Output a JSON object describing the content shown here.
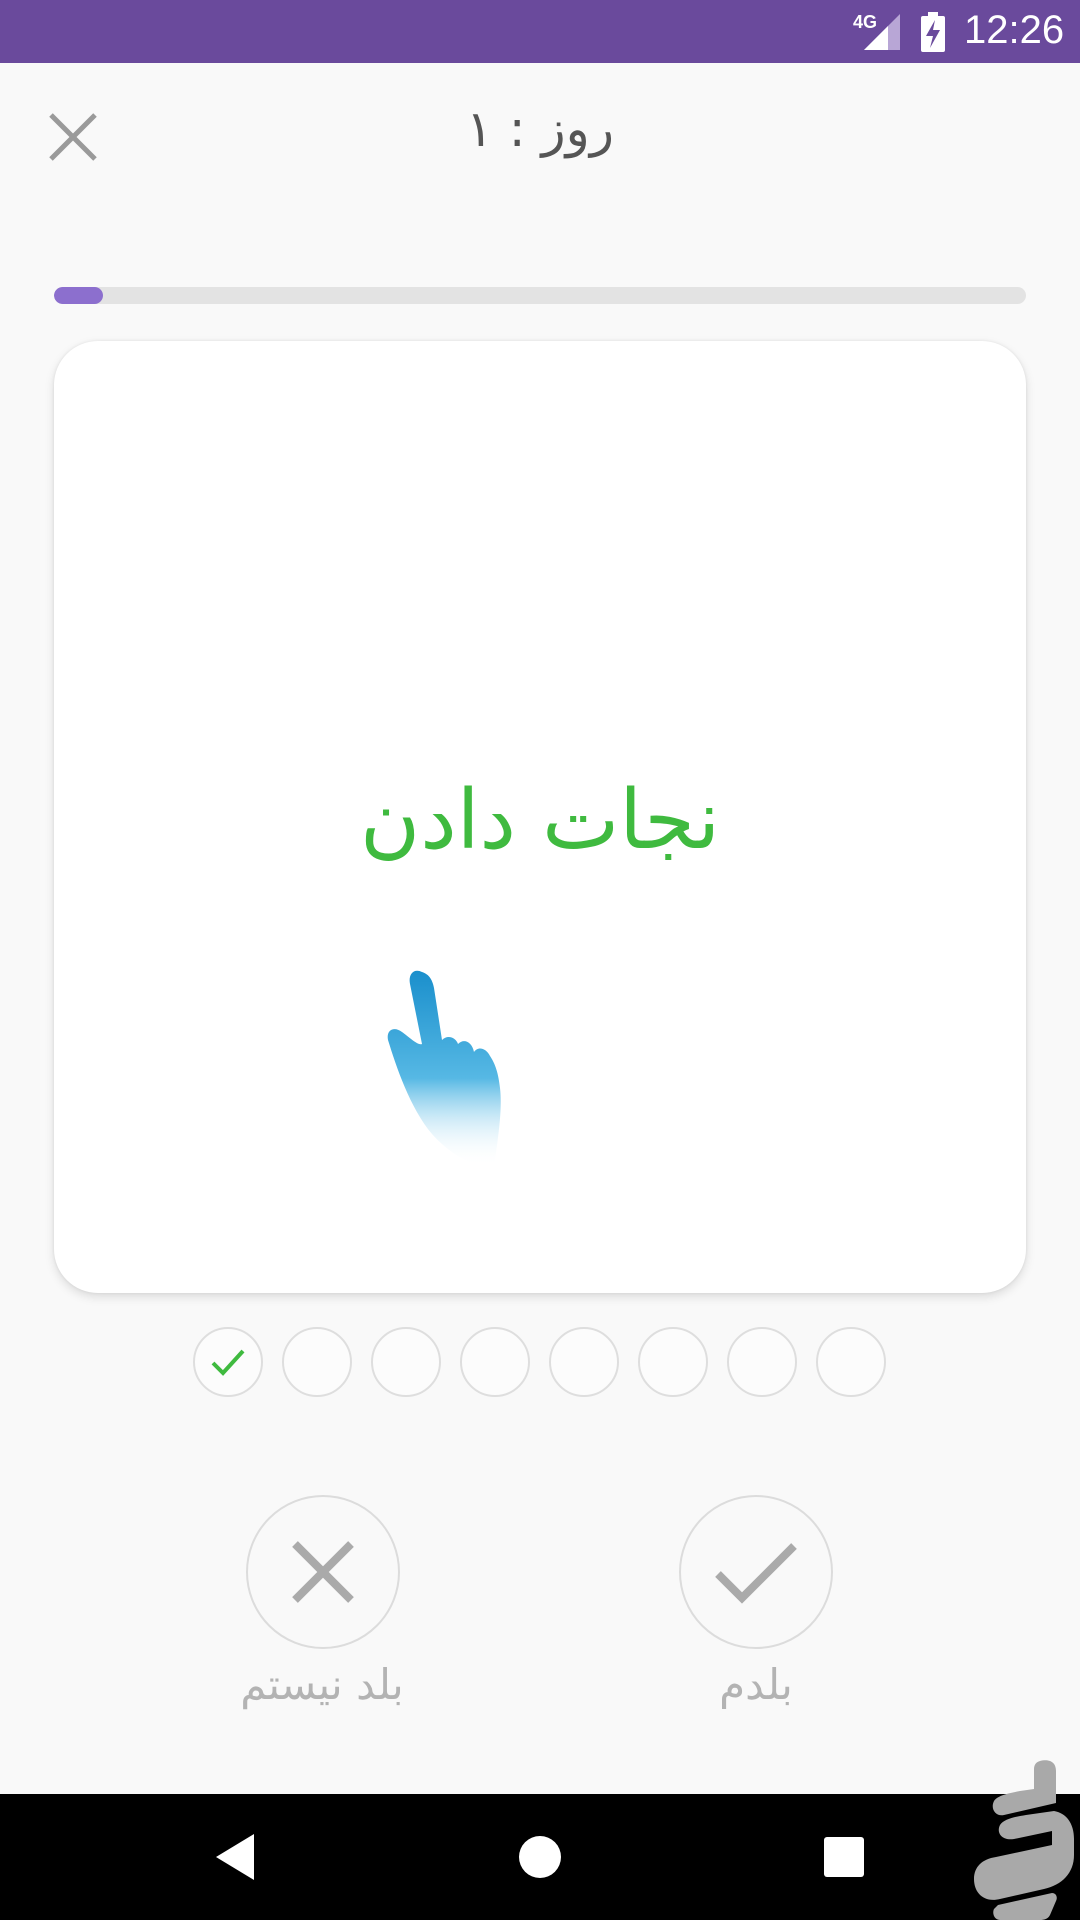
{
  "status_bar": {
    "network": "4G",
    "time": "12:26",
    "background_color": "#6a4a9c",
    "icons": [
      "signal-icon",
      "battery-charging-icon"
    ]
  },
  "header": {
    "title": "روز : ۱",
    "close_icon": "close-icon"
  },
  "progress": {
    "fraction": 0.05,
    "fill_color": "#8c6fce",
    "track_color": "#e3e3e3"
  },
  "card": {
    "word": "نجات دادن",
    "word_color": "#3fba3f",
    "hint_icon": "pointing-hand-icon"
  },
  "review_dots": [
    {
      "state": "done"
    },
    {
      "state": "empty"
    },
    {
      "state": "empty"
    },
    {
      "state": "empty"
    },
    {
      "state": "empty"
    },
    {
      "state": "empty"
    },
    {
      "state": "empty"
    },
    {
      "state": "empty"
    }
  ],
  "actions": {
    "dont_know_label": "بلد نیستم",
    "know_label": "بلدم",
    "dont_know_icon": "x-icon",
    "know_icon": "check-icon"
  },
  "nav_bar": {
    "buttons": [
      "back-icon",
      "home-icon",
      "recents-icon"
    ]
  },
  "watermark_icon": "store-logo-icon"
}
